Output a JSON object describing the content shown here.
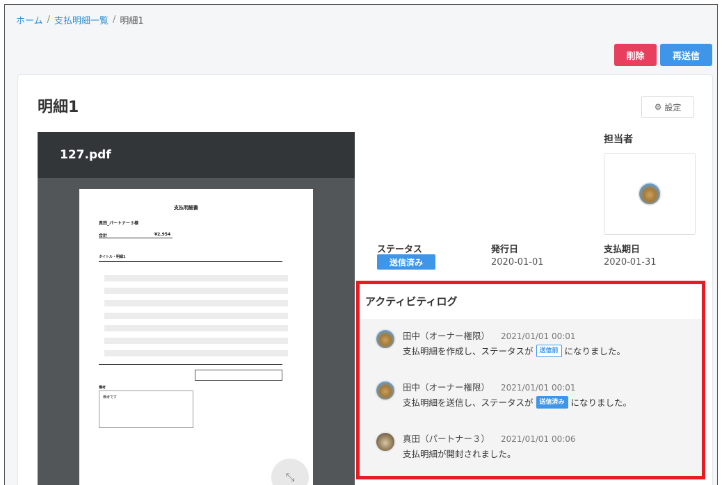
{
  "breadcrumb": {
    "home": "ホーム",
    "list": "支払明細一覧",
    "current": "明細1",
    "separator": "/"
  },
  "actions": {
    "delete_label": "削除",
    "resend_label": "再送信",
    "delete_color": "#e83f5e",
    "resend_color": "#3f96e8"
  },
  "page": {
    "title": "明細1",
    "settings_label": "設定"
  },
  "pdf": {
    "filename": "127.pdf",
    "doc_title": "支払明細書",
    "recipient": "真田_パートナー３様",
    "total_label": "合計",
    "total_value": "¥2,954",
    "section_label": "タイトル・明細1",
    "notes_label": "備考",
    "notes_text": "備考です"
  },
  "assignee": {
    "label": "担当者"
  },
  "meta": {
    "status_label": "ステータス",
    "status_value": "送信済み",
    "issue_label": "発行日",
    "issue_value": "2020-01-01",
    "due_label": "支払期日",
    "due_value": "2020-01-31"
  },
  "activity": {
    "title": "アクティビティログ",
    "items": [
      {
        "user": "田中（オーナー権限）",
        "time": "2021/01/01 00:01",
        "msg_before": "支払明細を作成し、ステータスが",
        "tag": "送信前",
        "msg_after": "になりました。"
      },
      {
        "user": "田中（オーナー権限）",
        "time": "2021/01/01 00:01",
        "msg_before": "支払明細を送信し、ステータスが",
        "tag": "送信済み",
        "msg_after": "になりました。"
      },
      {
        "user": "真田（パートナー３）",
        "time": "2021/01/01 00:06",
        "msg_before": "支払明細が開封されました。"
      }
    ]
  }
}
